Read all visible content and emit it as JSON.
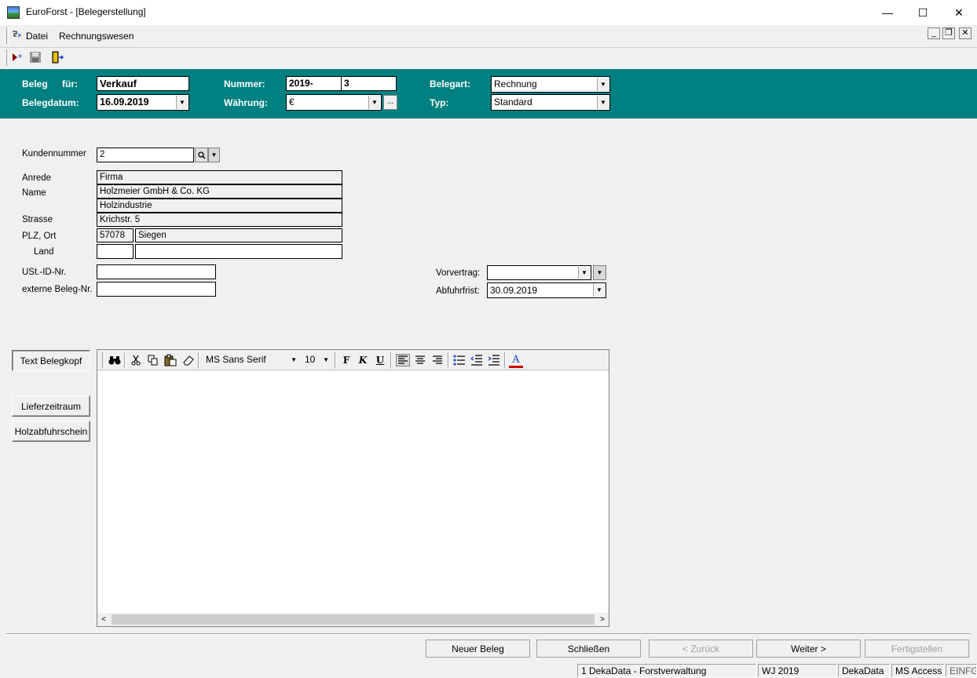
{
  "window": {
    "title": "EuroForst - [Belegerstellung]",
    "controls": {
      "minimize": "—",
      "maximize": "☐",
      "close": "✕"
    }
  },
  "menu": {
    "items": [
      {
        "label": "Datei"
      },
      {
        "label": "Rechnungswesen"
      }
    ],
    "mdi": {
      "minimize": "_",
      "restore": "❐",
      "close": "✕"
    }
  },
  "toolbar": {
    "icons": [
      "new-document-icon",
      "save-icon",
      "exit-door-icon"
    ]
  },
  "header": {
    "beleg_label": "Beleg",
    "fuer_label": "für:",
    "fuer_value": "Verkauf",
    "belegdatum_label": "Belegdatum:",
    "belegdatum_value": "16.09.2019",
    "nummer_label": "Nummer:",
    "nummer_prefix": "2019-",
    "nummer_value": "3",
    "waehrung_label": "Währung:",
    "waehrung_value": "€",
    "waehrung_more": "...",
    "belegart_label": "Belegart:",
    "belegart_value": "Rechnung",
    "typ_label": "Typ:",
    "typ_value": "Standard"
  },
  "customer": {
    "kundennummer_label": "Kundennummer",
    "kundennummer_value": "2",
    "anrede_label": "Anrede",
    "anrede_value": "Firma",
    "name_label": "Name",
    "name_value": "Holzmeier GmbH & Co. KG",
    "name2_value": "Holzindustrie",
    "strasse_label": "Strasse",
    "strasse_value": "Krichstr. 5",
    "plzort_label": "PLZ, Ort",
    "plz_value": "57078",
    "ort_value": "Siegen",
    "land_label": "Land",
    "land_code_value": "",
    "land_value": "",
    "ustid_label": "USt.-ID-Nr.",
    "ustid_value": "",
    "externe_label": "externe Beleg-Nr.",
    "externe_value": ""
  },
  "contract": {
    "vorvertrag_label": "Vorvertrag:",
    "vorvertrag_value": "",
    "abfuhrfrist_label": "Abfuhrfrist:",
    "abfuhrfrist_value": "30.09.2019"
  },
  "side_buttons": {
    "text_belegkopf": "Text Belegkopf",
    "lieferzeitraum": "Lieferzeitraum",
    "holzabfuhrschein": "Holzabfuhrschein"
  },
  "editor": {
    "font_name": "MS Sans Serif",
    "font_size": "10",
    "bold": "F",
    "italic": "K",
    "underline": "U",
    "font_color": "A",
    "content": ""
  },
  "footer": {
    "neuer_beleg": "Neuer Beleg",
    "schliessen": "Schließen",
    "zurueck": "< Zurück",
    "weiter": "Weiter >",
    "fertigstellen": "Fertigstellen"
  },
  "statusbar": {
    "company": "1 DekaData - Forstverwaltung",
    "wj": "WJ 2019",
    "vendor": "DekaData",
    "db": "MS Access",
    "mode": "EINFG"
  },
  "colors": {
    "header_band": "#008080",
    "window_bg": "#f0f0f0",
    "font_color_icon": "#cc0000"
  }
}
